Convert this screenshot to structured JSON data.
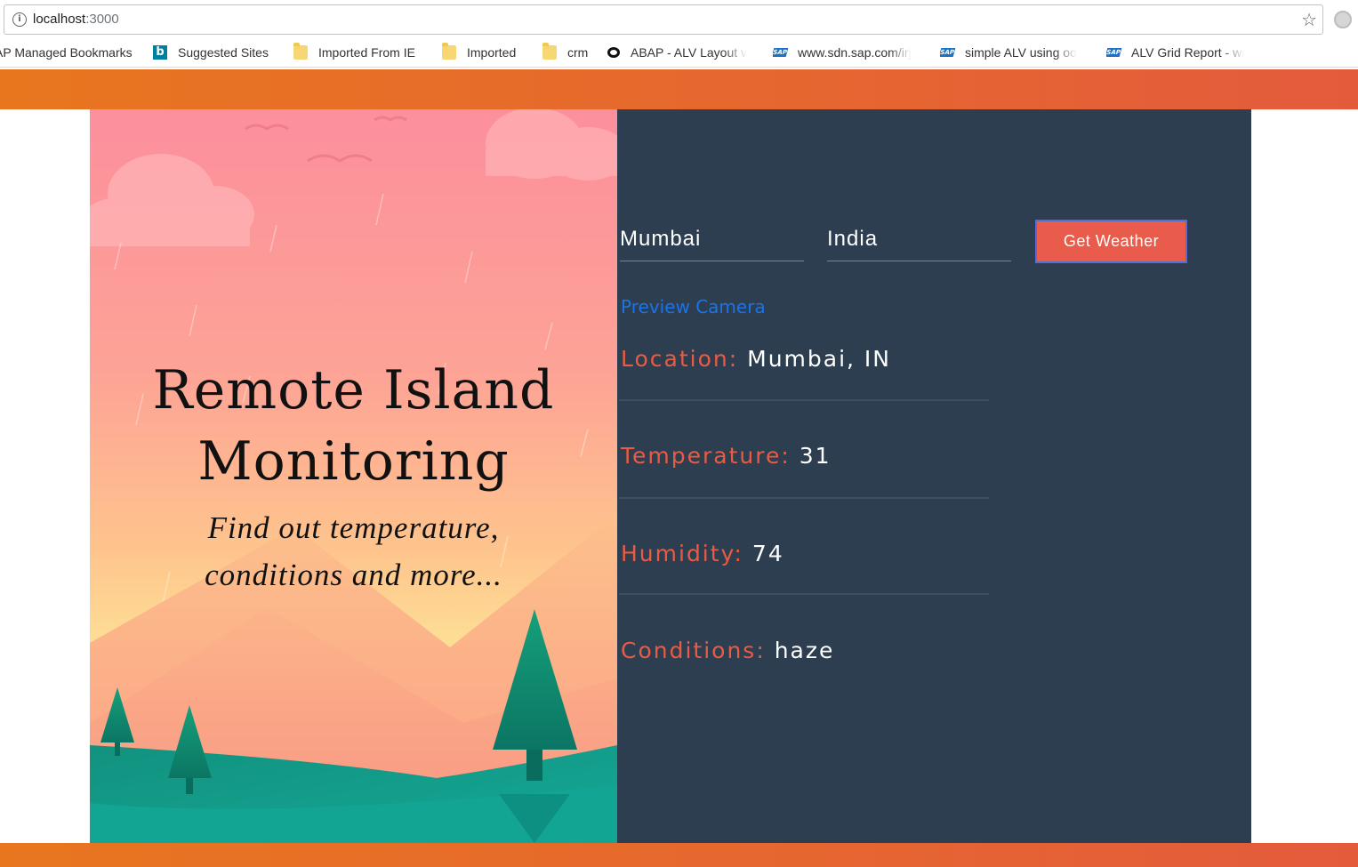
{
  "browser": {
    "url_host": "localhost",
    "url_port": ":3000",
    "bookmarks": [
      {
        "label": "AP Managed Bookmarks",
        "icon": "text"
      },
      {
        "label": "Suggested Sites",
        "icon": "bing-icon"
      },
      {
        "label": "Imported From IE",
        "icon": "folder-icon"
      },
      {
        "label": "Imported",
        "icon": "folder-icon"
      },
      {
        "label": "crm",
        "icon": "folder-icon"
      },
      {
        "label": "ABAP - ALV Layout v",
        "icon": "ring-icon"
      },
      {
        "label": "www.sdn.sap.com/irj",
        "icon": "sap-icon"
      },
      {
        "label": "simple ALV using oo",
        "icon": "sap-icon"
      },
      {
        "label": "ALV Grid Report - wi",
        "icon": "sap-icon"
      }
    ]
  },
  "hero": {
    "title_line1": "Remote Island",
    "title_line2": "Monitoring",
    "subtitle_line1": "Find out temperature,",
    "subtitle_line2": "conditions and more..."
  },
  "form": {
    "city_value": "Mumbai",
    "country_value": "India",
    "button_label": "Get Weather"
  },
  "preview_link": "Preview Camera",
  "weather": {
    "location_label": "Location:",
    "location_value": "Mumbai, IN",
    "temperature_label": "Temperature:",
    "temperature_value": "31",
    "humidity_label": "Humidity:",
    "humidity_value": "74",
    "conditions_label": "Conditions:",
    "conditions_value": "haze"
  },
  "colors": {
    "accent": "#e85c44",
    "panel": "#2d3e50",
    "link": "#1a73e8",
    "bar_start": "#e8761f",
    "bar_end": "#e45b3c"
  }
}
